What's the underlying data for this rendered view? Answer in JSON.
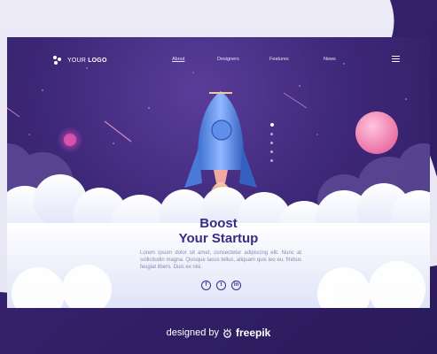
{
  "colors": {
    "card_bg": "#3e2878",
    "headline": "#3a2b86",
    "planet": "#f28fb8",
    "rocket": "#5b8fe0"
  },
  "header": {
    "logo_prefix": "YOUR",
    "logo_bold": "LOGO",
    "nav": [
      {
        "label": "About",
        "active": true
      },
      {
        "label": "Designers",
        "active": false
      },
      {
        "label": "Features",
        "active": false
      },
      {
        "label": "News",
        "active": false
      }
    ],
    "menu_icon": "hamburger-icon"
  },
  "slider": {
    "count": 5,
    "active_index": 0
  },
  "hero": {
    "title_line1": "Boost",
    "title_line2": "Your Startup",
    "body": "Lorem ipsum dolor sit amet, consectetur adipiscing elit. Nunc at sollicitudin magna. Quisque lacus tellus, aliquam quis leo eu, finibus feugiat libero. Duis ex nisi."
  },
  "social": [
    {
      "icon": "facebook-icon",
      "glyph": "f"
    },
    {
      "icon": "twitter-icon",
      "glyph": "t"
    },
    {
      "icon": "linkedin-icon",
      "glyph": "in"
    }
  ],
  "credit": {
    "prefix": "designed by",
    "brand": "freepik"
  }
}
